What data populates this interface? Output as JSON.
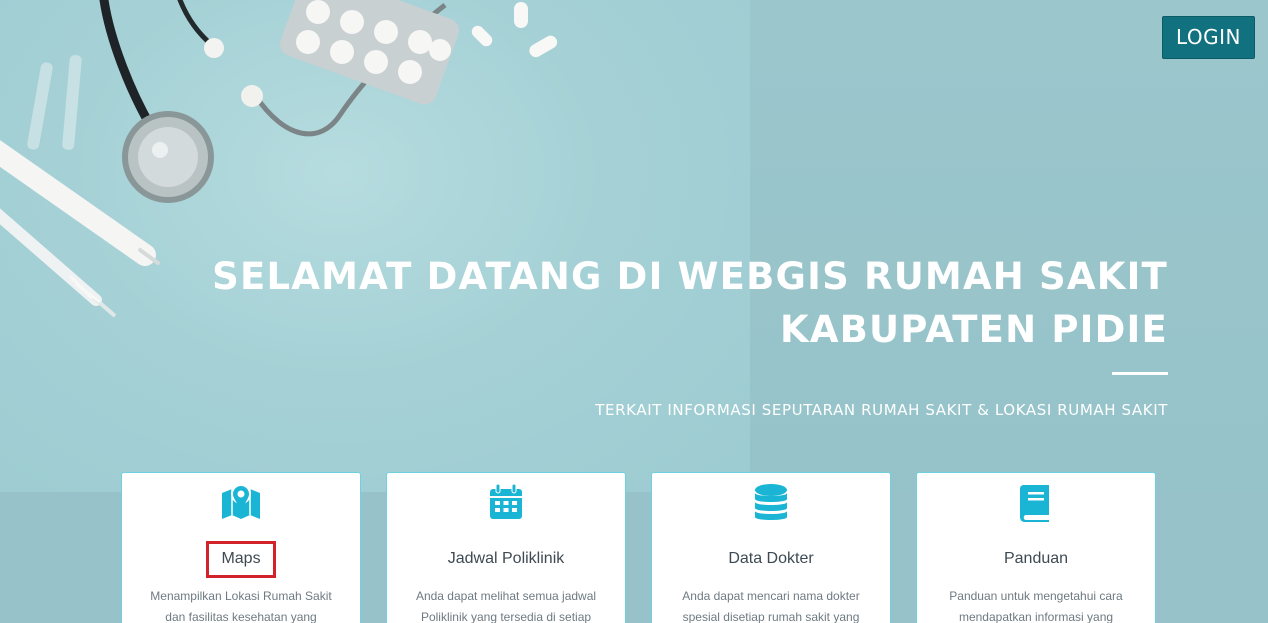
{
  "header": {
    "login_label": "LOGIN"
  },
  "hero": {
    "title_line1": "SELAMAT DATANG DI WEBGIS RUMAH SAKIT",
    "title_line2": "KABUPATEN PIDIE",
    "subtitle": "TERKAIT INFORMASI SEPUTARAN RUMAH SAKIT & LOKASI RUMAH SAKIT"
  },
  "cards": [
    {
      "icon": "map-icon",
      "title": "Maps",
      "desc": "Menampilkan Lokasi Rumah Sakit dan fasilitas kesehatan yang"
    },
    {
      "icon": "calendar-icon",
      "title": "Jadwal Poliklinik",
      "desc": "Anda dapat melihat semua jadwal Poliklinik yang tersedia di setiap"
    },
    {
      "icon": "database-icon",
      "title": "Data Dokter",
      "desc": "Anda dapat mencari nama dokter spesial disetiap rumah sakit yang"
    },
    {
      "icon": "book-icon",
      "title": "Panduan",
      "desc": "Panduan untuk mengetahui cara mendapatkan informasi yang"
    }
  ],
  "colors": {
    "accent": "#1ab5d5",
    "login_bg": "#11717f",
    "highlight_border": "#d3232a",
    "background": "#97c2c9"
  }
}
